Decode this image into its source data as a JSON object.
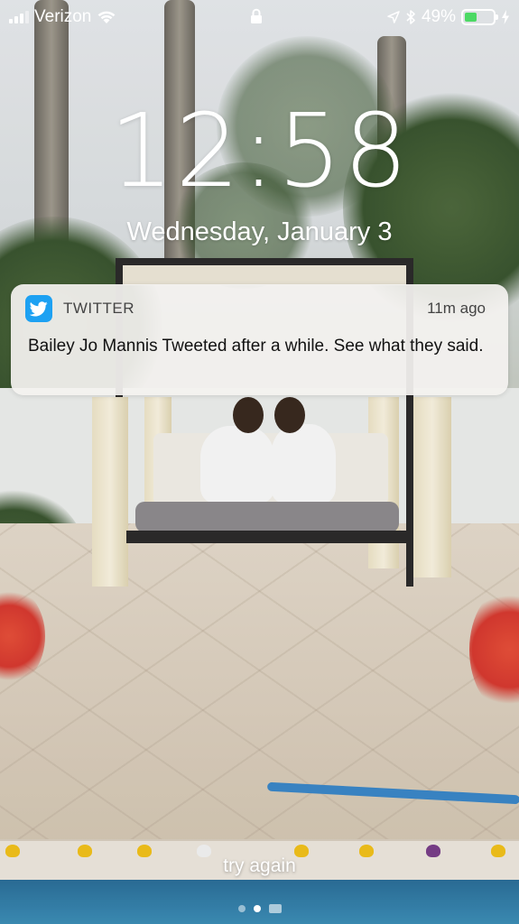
{
  "status_bar": {
    "carrier": "Verizon",
    "signal_bars": 3,
    "signal_bars_total": 4,
    "battery_percent": "49%",
    "battery_level": 0.49,
    "icons": [
      "signal-icon",
      "wifi-icon",
      "lock-icon",
      "location-icon",
      "bluetooth-icon",
      "battery-icon",
      "charging-icon"
    ]
  },
  "lock_screen": {
    "time": "12:58",
    "date": "Wednesday, January 3"
  },
  "notification": {
    "app_icon": "twitter-bird-icon",
    "app_name": "TWITTER",
    "time_ago": "11m ago",
    "body": "Bailey Jo Mannis Tweeted after a while. See what they said."
  },
  "bottom": {
    "try_again": "try again",
    "page_count": 2,
    "active_page": 1
  },
  "colors": {
    "battery_fill": "#4cd964",
    "twitter_blue": "#1da1f2"
  }
}
